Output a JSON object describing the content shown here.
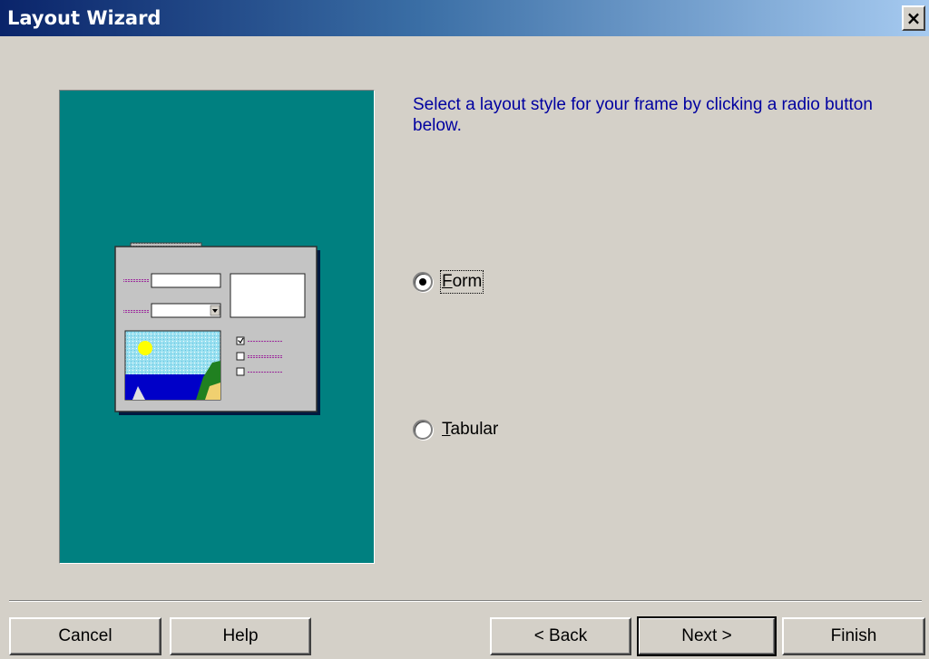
{
  "window": {
    "title": "Layout Wizard",
    "close_symbol": "×"
  },
  "instruction": "Select a layout style for your frame by clicking a radio button below.",
  "options": [
    {
      "label_accel": "F",
      "label_rest": "orm",
      "selected": true
    },
    {
      "label_accel": "T",
      "label_rest": "abular",
      "selected": false
    }
  ],
  "buttons": {
    "cancel": "Cancel",
    "help": "Help",
    "back": "< Back",
    "next": "Next >",
    "finish": "Finish"
  },
  "preview": {
    "icon": "form-layout-illustration",
    "panel_color": "#008080"
  }
}
